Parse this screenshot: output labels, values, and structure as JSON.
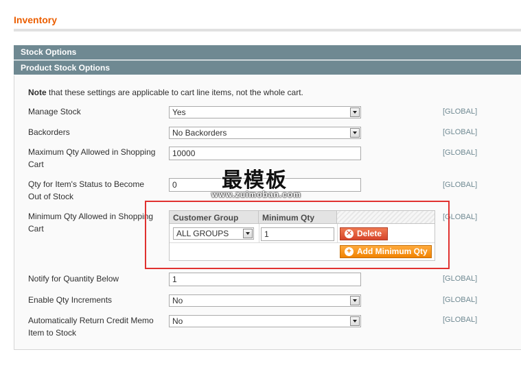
{
  "page": {
    "title": "Inventory"
  },
  "sections": {
    "stock_options": "Stock Options",
    "product_stock_options": "Product Stock Options"
  },
  "note": {
    "bold": "Note",
    "text": " that these settings are applicable to cart line items, not the whole cart."
  },
  "fields": {
    "manage_stock": {
      "label": "Manage Stock",
      "value": "Yes",
      "scope": "[GLOBAL]"
    },
    "backorders": {
      "label": "Backorders",
      "value": "No Backorders",
      "scope": "[GLOBAL]"
    },
    "max_qty": {
      "label": "Maximum Qty Allowed in Shopping Cart",
      "value": "10000",
      "scope": "[GLOBAL]"
    },
    "out_of_stock_qty": {
      "label": "Qty for Item's Status to Become Out of Stock",
      "value": "0",
      "scope": "[GLOBAL]"
    },
    "min_qty": {
      "label": "Minimum Qty Allowed in Shopping Cart",
      "scope": "[GLOBAL]"
    },
    "notify_below": {
      "label": "Notify for Quantity Below",
      "value": "1",
      "scope": "[GLOBAL]"
    },
    "qty_increments": {
      "label": "Enable Qty Increments",
      "value": "No",
      "scope": "[GLOBAL]"
    },
    "return_credit_memo": {
      "label": "Automatically Return Credit Memo Item to Stock",
      "value": "No",
      "scope": "[GLOBAL]"
    }
  },
  "min_qty_grid": {
    "headers": {
      "customer_group": "Customer Group",
      "minimum_qty": "Minimum Qty"
    },
    "rows": [
      {
        "customer_group": "ALL GROUPS",
        "minimum_qty": "1"
      }
    ],
    "delete_label": "Delete",
    "add_label": "Add Minimum Qty"
  },
  "watermark": {
    "text": "最模板",
    "url": "www.zuimoban.com"
  },
  "colors": {
    "title": "#eb5e00",
    "section_bar": "#6f8992",
    "scope": "#6f8992",
    "button_add": "#f18200",
    "button_delete": "#d6442a",
    "highlight": "#e0312f"
  },
  "icons": {
    "delete": "x-circle-icon",
    "add": "plus-circle-icon",
    "select": "chevron-down-icon"
  }
}
